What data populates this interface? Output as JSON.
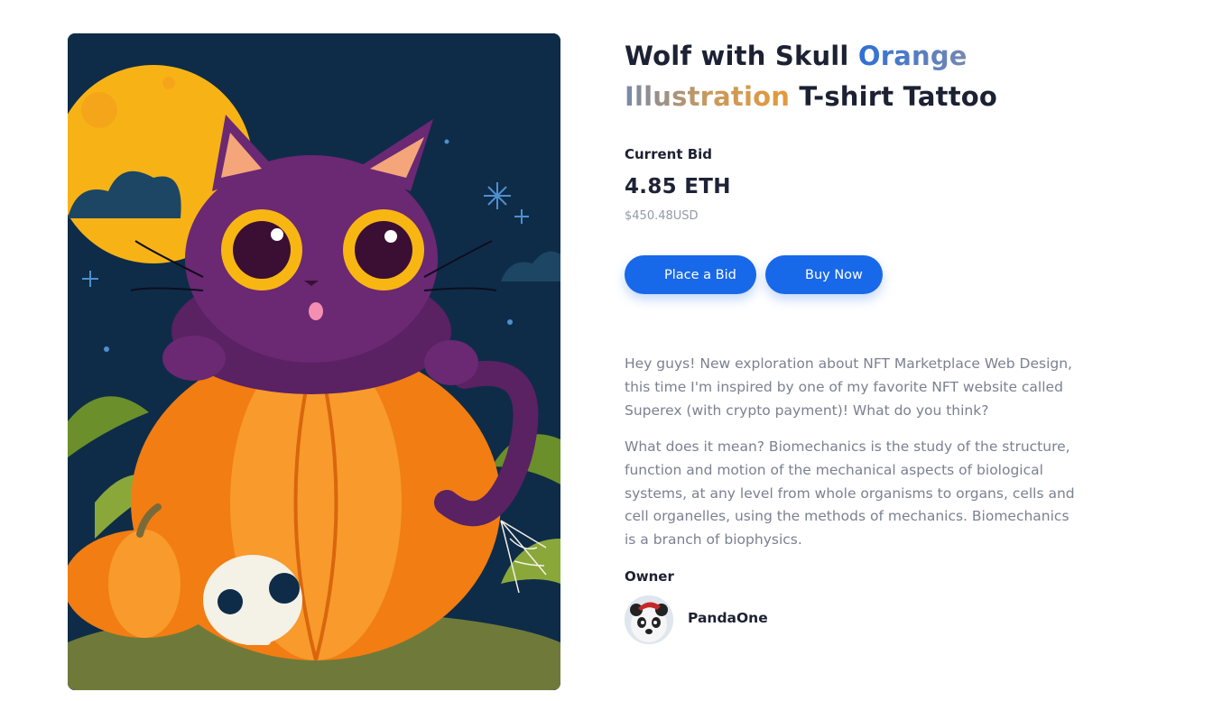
{
  "product": {
    "title_part1": "Wolf with Skull",
    "title_highlight": "Orange Illustration",
    "title_part2": "T-shirt Tattoo",
    "artwork_label": "halloween-cat-pumpkin-artwork"
  },
  "bid": {
    "label": "Current Bid",
    "price": "4.85 ETH",
    "usd": "$450.48USD"
  },
  "actions": {
    "place_bid": "Place a Bid",
    "buy_now": "Buy Now"
  },
  "description": {
    "p1": "Hey guys! New exploration about NFT Marketplace Web Design, this time I'm inspired by one of my favorite NFT website called Superex (with crypto payment)! What do you think?",
    "p2": "What does it mean? Biomechanics is the study of the structure, function and motion of the mechanical aspects of biological systems, at any level from whole organisms to organs, cells and cell organelles, using the methods of mechanics. Biomechanics is a branch of biophysics."
  },
  "owner": {
    "label": "Owner",
    "name": "PandaOne",
    "avatar_icon": "panda-avatar"
  },
  "colors": {
    "accent": "#1868ea",
    "title": "#1c2133",
    "muted": "#7c8091",
    "gradient_start": "#2f6fd6",
    "gradient_end": "#e39a3b"
  }
}
